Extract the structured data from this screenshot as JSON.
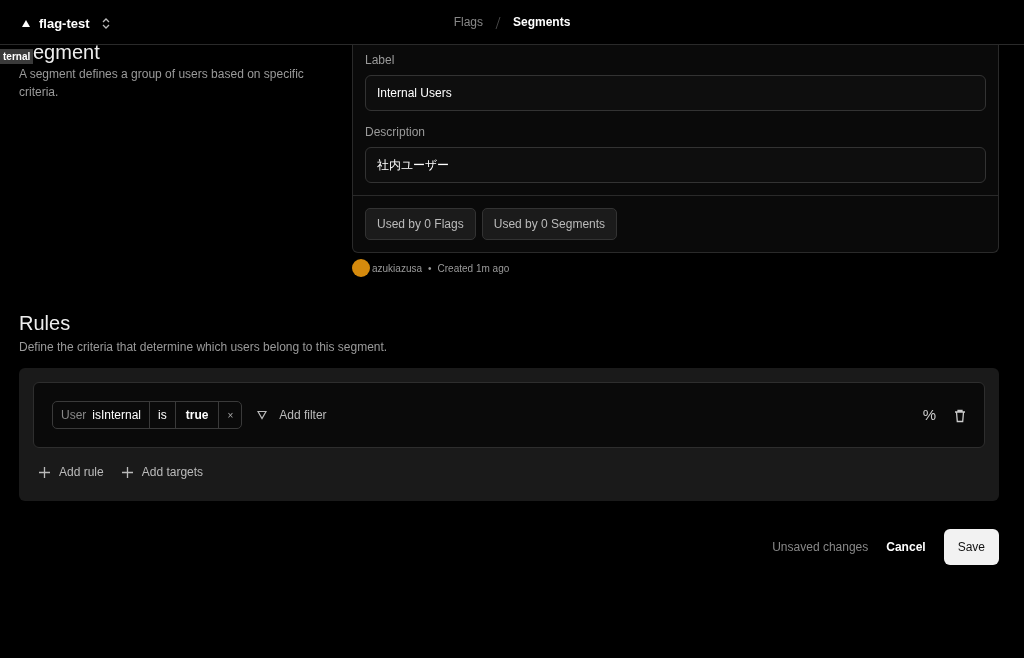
{
  "header": {
    "project": "flag-test",
    "breadcrumbs": [
      {
        "label": "Flags",
        "selected": false
      },
      {
        "label": "Segments",
        "selected": true
      }
    ]
  },
  "tooltip": "ternal",
  "segment": {
    "heading": "egment",
    "description": "A segment defines a group of users based on specific criteria.",
    "fields": [
      {
        "label": "Label",
        "value": "Internal Users"
      },
      {
        "label": "Description",
        "value": "社内ユーザー"
      }
    ],
    "usage": [
      "Used by 0 Flags",
      "Used by 0 Segments"
    ],
    "author": "azukiazusa",
    "separator": "•",
    "created": "Created 1m ago"
  },
  "rules": {
    "heading": "Rules",
    "description": "Define the criteria that determine which users belong to this segment.",
    "items": [
      {
        "filters": [
          {
            "entity": "User",
            "attribute": "isInternal",
            "operator": "is",
            "value": "true",
            "remove": "×"
          }
        ],
        "add_filter": "Add filter",
        "percent": "%"
      }
    ],
    "add_rule": "Add rule",
    "add_targets": "Add targets"
  },
  "footer": {
    "status": "Unsaved changes",
    "cancel": "Cancel",
    "save": "Save"
  }
}
